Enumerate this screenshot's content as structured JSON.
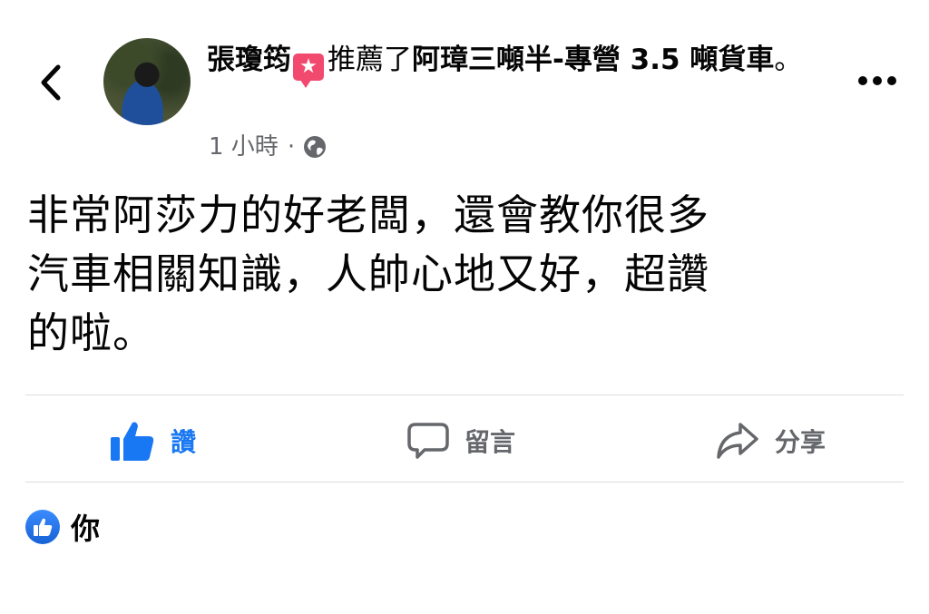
{
  "header": {
    "author": "張瓊筠",
    "badge_symbol": "★",
    "verb": "推薦了",
    "page_name": "阿璋三噸半-專營 3.5 噸貨車",
    "period": "。"
  },
  "meta": {
    "time": "1 小時",
    "separator": "·",
    "audience_icon": "globe-icon"
  },
  "post": {
    "lines": [
      "非常阿莎力的好老闆，還會教你很多",
      "汽車相關知識，人帥心地又好，超讚",
      "的啦。"
    ]
  },
  "actions": {
    "like": "讚",
    "comment": "留言",
    "share": "分享"
  },
  "reactions": {
    "who": "你"
  },
  "colors": {
    "accent": "#1877f2",
    "badge": "#f2496f",
    "muted": "#65676b"
  }
}
